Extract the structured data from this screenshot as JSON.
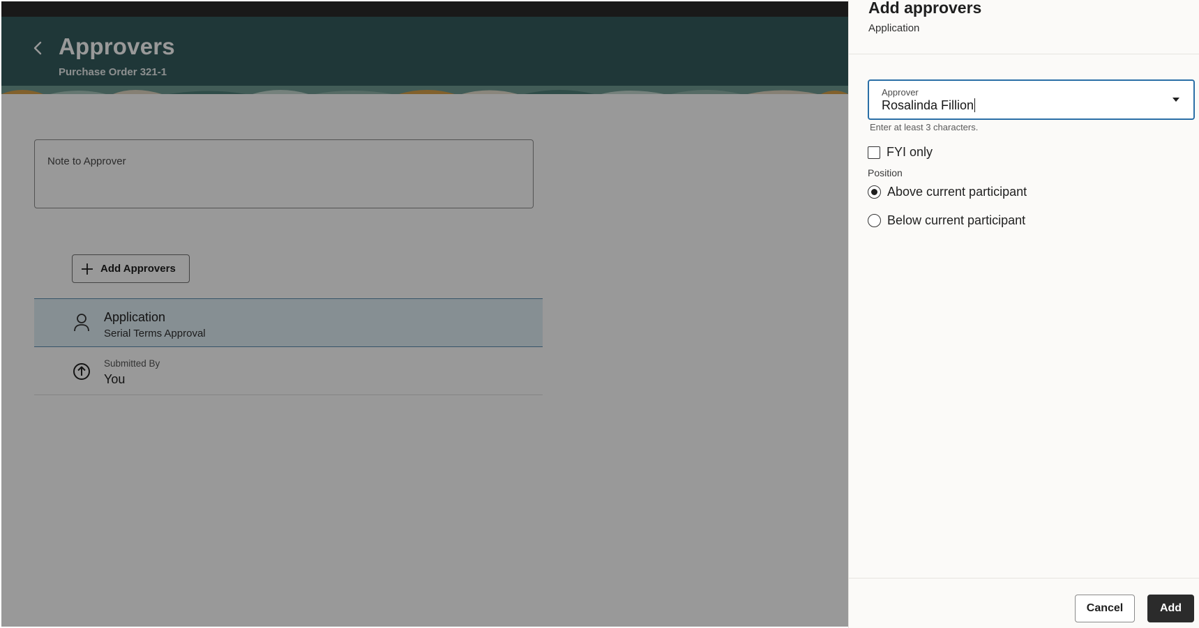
{
  "page": {
    "title": "Approvers",
    "subtitle": "Purchase Order 321-1",
    "back_icon": "chevron-left-icon"
  },
  "note": {
    "label": "Note to Approver"
  },
  "add_approvers_button": {
    "label": "Add Approvers",
    "icon": "plus-icon"
  },
  "approver_list": [
    {
      "title": "Application",
      "detail": "Serial Terms Approval",
      "icon": "person-icon",
      "selected": true
    },
    {
      "caption": "Submitted By",
      "title": "You",
      "icon": "arrow-up-circle-icon",
      "selected": false
    }
  ],
  "drawer": {
    "title": "Add approvers",
    "subtitle": "Application",
    "approver_field": {
      "label": "Approver",
      "value": "Rosalinda Fillion",
      "helper": "Enter at least 3 characters."
    },
    "fyi": {
      "label": "FYI only",
      "checked": false
    },
    "position": {
      "label": "Position",
      "options": [
        {
          "label": "Above current participant",
          "selected": true
        },
        {
          "label": "Below current participant",
          "selected": false
        }
      ]
    },
    "cancel_label": "Cancel",
    "add_label": "Add"
  },
  "colors": {
    "header_bg": "#355c5e",
    "selected_row_bg": "#e0eef6",
    "focus_border": "#2a6ea6",
    "primary_button": "#2b2b2b"
  }
}
